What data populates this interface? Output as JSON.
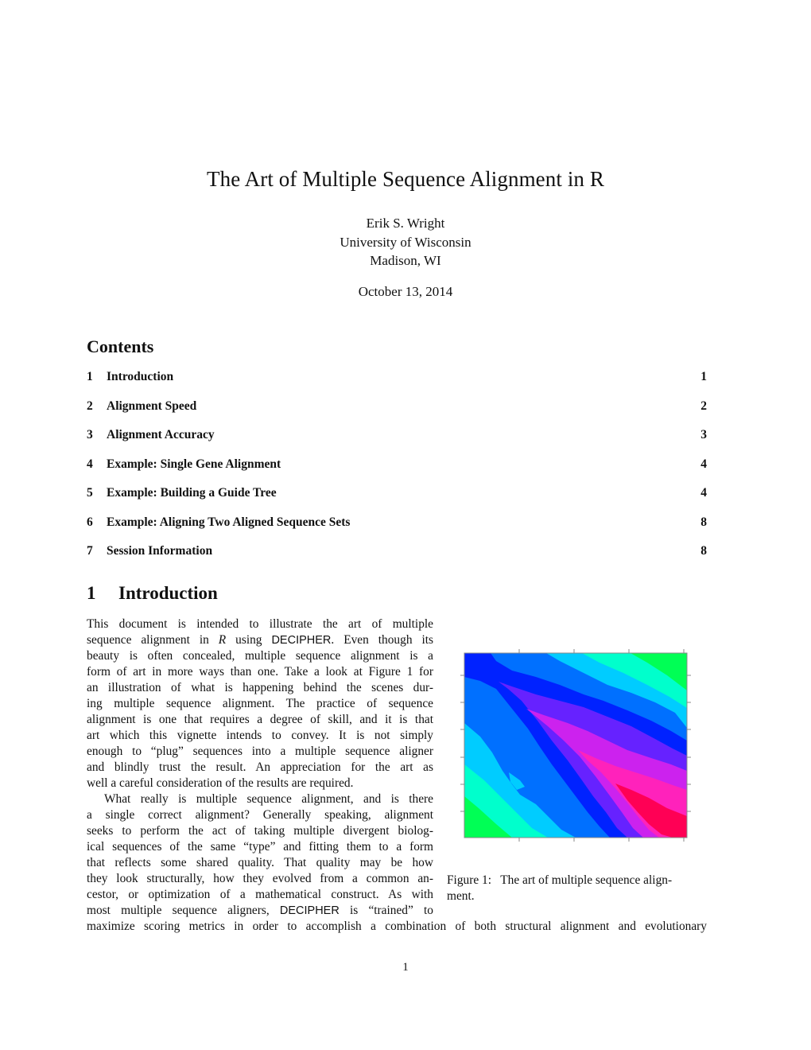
{
  "document": {
    "title": "The Art of Multiple Sequence Alignment in R",
    "author": "Erik S. Wright",
    "affiliation": "University of Wisconsin",
    "location": "Madison, WI",
    "date": "October 13, 2014",
    "page_number": "1"
  },
  "contents": {
    "heading": "Contents",
    "items": [
      {
        "num": "1",
        "label": "Introduction",
        "page": "1"
      },
      {
        "num": "2",
        "label": "Alignment Speed",
        "page": "2"
      },
      {
        "num": "3",
        "label": "Alignment Accuracy",
        "page": "3"
      },
      {
        "num": "4",
        "label": "Example: Single Gene Alignment",
        "page": "4"
      },
      {
        "num": "5",
        "label": "Example: Building a Guide Tree",
        "page": "4"
      },
      {
        "num": "6",
        "label": "Example: Aligning Two Aligned Sequence Sets",
        "page": "8"
      },
      {
        "num": "7",
        "label": "Session Information",
        "page": "8"
      }
    ]
  },
  "section1": {
    "num": "1",
    "title": "Introduction",
    "para1_lines": [
      "This document is intended to illustrate the art of multiple",
      [
        "sequence alignment in ",
        {
          "i": "R"
        },
        " using ",
        {
          "s": "DECIPHER"
        },
        ". Even though its"
      ],
      "beauty is often concealed, multiple sequence alignment is a",
      "form of art in more ways than one. Take a look at Figure 1 for",
      "an illustration of what is happening behind the scenes dur-",
      "ing multiple sequence alignment. The practice of sequence",
      "alignment is one that requires a degree of skill, and it is that",
      "art which this vignette intends to convey. It is not simply",
      "enough to “plug” sequences into a multiple sequence aligner",
      "and blindly trust the result. An appreciation for the art as",
      "well a careful consideration of the results are required."
    ],
    "para2_lines": [
      "What really is multiple sequence alignment, and is there",
      "a single correct alignment? Generally speaking, alignment",
      "seeks to perform the act of taking multiple divergent biolog-",
      "ical sequences of the same “type” and fitting them to a form",
      "that reflects some shared quality. That quality may be how",
      "they look structurally, how they evolved from a common an-",
      "cestor, or optimization of a mathematical construct. As with",
      [
        "most multiple sequence aligners, ",
        {
          "s": "DECIPHER"
        },
        " is “trained” to"
      ]
    ],
    "last_line": "maximize scoring metrics in order to accomplish a combination of both structural alignment and evolutionary"
  },
  "figure1": {
    "caption": "Figure 1:  The art of multiple sequence align-ment.",
    "caption_line1": "Figure 1:  The art of multiple sequence align-",
    "caption_line2": "ment.",
    "palette": [
      "#00ff55",
      "#00ffcc",
      "#00ccff",
      "#0070ff",
      "#0022ff",
      "#6622ff",
      "#cc22ee",
      "#ff22bb",
      "#ff0055"
    ]
  }
}
